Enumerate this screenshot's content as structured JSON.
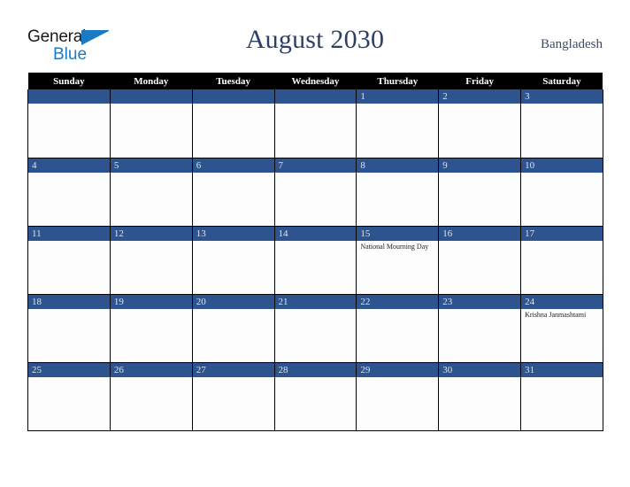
{
  "brand": {
    "name_part1": "General",
    "name_part2": "Blue",
    "triangle_icon": "blue-triangle-icon",
    "color_text": "#1a1a1a",
    "color_blue": "#1b7ac4"
  },
  "header": {
    "title": "August 2030",
    "location": "Bangladesh",
    "title_color": "#2d3f63",
    "location_color": "#3b4a68"
  },
  "calendar": {
    "month": "August",
    "year": "2030",
    "header_bg": "#000000",
    "daynum_bg": "#2e5490",
    "daynum_color": "#dfe3ec",
    "weekdays": [
      "Sunday",
      "Monday",
      "Tuesday",
      "Wednesday",
      "Thursday",
      "Friday",
      "Saturday"
    ],
    "weeks": [
      [
        {
          "day": "",
          "events": []
        },
        {
          "day": "",
          "events": []
        },
        {
          "day": "",
          "events": []
        },
        {
          "day": "",
          "events": []
        },
        {
          "day": "1",
          "events": []
        },
        {
          "day": "2",
          "events": []
        },
        {
          "day": "3",
          "events": []
        }
      ],
      [
        {
          "day": "4",
          "events": []
        },
        {
          "day": "5",
          "events": []
        },
        {
          "day": "6",
          "events": []
        },
        {
          "day": "7",
          "events": []
        },
        {
          "day": "8",
          "events": []
        },
        {
          "day": "9",
          "events": []
        },
        {
          "day": "10",
          "events": []
        }
      ],
      [
        {
          "day": "11",
          "events": []
        },
        {
          "day": "12",
          "events": []
        },
        {
          "day": "13",
          "events": []
        },
        {
          "day": "14",
          "events": []
        },
        {
          "day": "15",
          "events": [
            "National Mourning Day"
          ]
        },
        {
          "day": "16",
          "events": []
        },
        {
          "day": "17",
          "events": []
        }
      ],
      [
        {
          "day": "18",
          "events": []
        },
        {
          "day": "19",
          "events": []
        },
        {
          "day": "20",
          "events": []
        },
        {
          "day": "21",
          "events": []
        },
        {
          "day": "22",
          "events": []
        },
        {
          "day": "23",
          "events": []
        },
        {
          "day": "24",
          "events": [
            "Krishna Janmashtami"
          ]
        }
      ],
      [
        {
          "day": "25",
          "events": []
        },
        {
          "day": "26",
          "events": []
        },
        {
          "day": "27",
          "events": []
        },
        {
          "day": "28",
          "events": []
        },
        {
          "day": "29",
          "events": []
        },
        {
          "day": "30",
          "events": []
        },
        {
          "day": "31",
          "events": []
        }
      ]
    ]
  }
}
